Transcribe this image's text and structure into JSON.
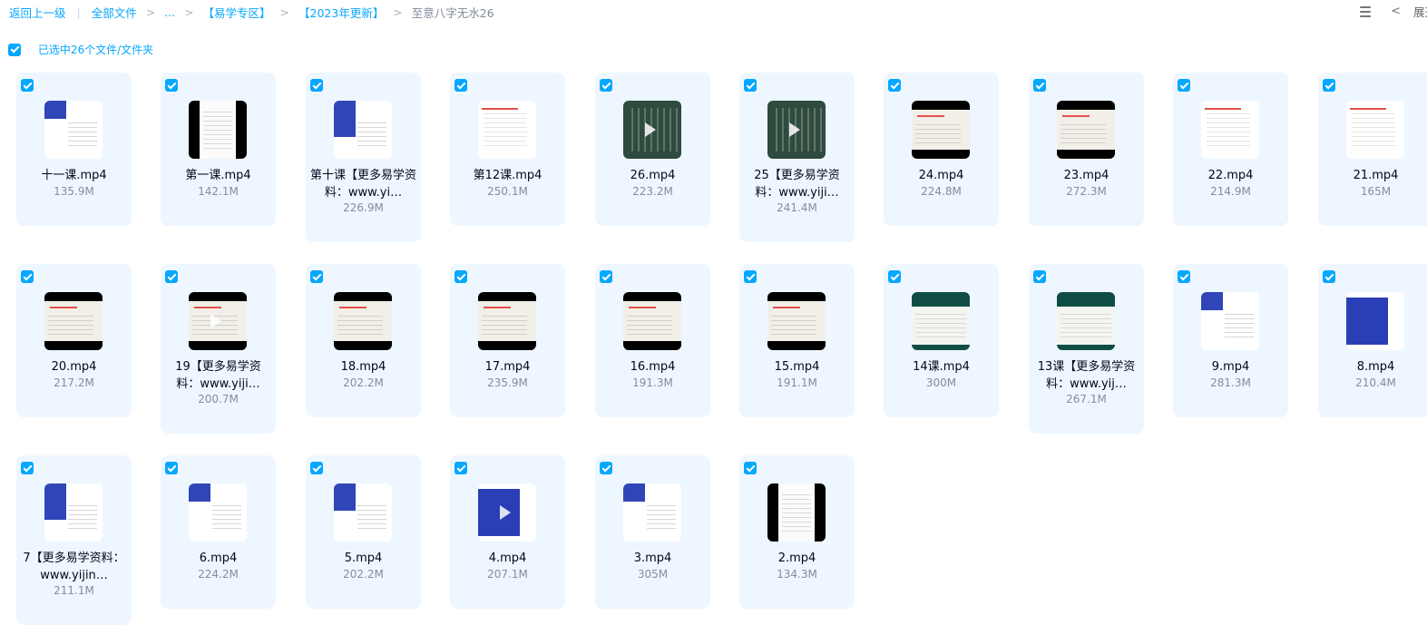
{
  "breadcrumb": {
    "back": "返回上一级",
    "items": [
      "全部文件",
      "...",
      "【易学专区】",
      "【2023年更新】"
    ],
    "current": "至意八字无水26"
  },
  "toolbar": {
    "list_view_icon": "list-view-icon",
    "collapse_icon": "chevron-left-icon",
    "expand_label": "展开"
  },
  "selection": {
    "label": "已选中26个文件/文件夹"
  },
  "colors": {
    "accent": "#06a7ff",
    "card_bg": "#eef7ff",
    "size_text": "#878c9c"
  },
  "files": [
    {
      "name": "十一课.mp4",
      "size": "135.9M"
    },
    {
      "name": "第一课.mp4",
      "size": "142.1M"
    },
    {
      "name": "第十课【更多易学资料：www.yi…",
      "size": "226.9M"
    },
    {
      "name": "第12课.mp4",
      "size": "250.1M"
    },
    {
      "name": "26.mp4",
      "size": "223.2M"
    },
    {
      "name": "25【更多易学资料：www.yiji…",
      "size": "241.4M"
    },
    {
      "name": "24.mp4",
      "size": "224.8M"
    },
    {
      "name": "23.mp4",
      "size": "272.3M"
    },
    {
      "name": "22.mp4",
      "size": "214.9M"
    },
    {
      "name": "21.mp4",
      "size": "165M"
    },
    {
      "name": "20.mp4",
      "size": "217.2M"
    },
    {
      "name": "19【更多易学资料：www.yiji…",
      "size": "200.7M"
    },
    {
      "name": "18.mp4",
      "size": "202.2M"
    },
    {
      "name": "17.mp4",
      "size": "235.9M"
    },
    {
      "name": "16.mp4",
      "size": "191.3M"
    },
    {
      "name": "15.mp4",
      "size": "191.1M"
    },
    {
      "name": "14课.mp4",
      "size": "300M"
    },
    {
      "name": "13课【更多易学资料：www.yij…",
      "size": "267.1M"
    },
    {
      "name": "9.mp4",
      "size": "281.3M"
    },
    {
      "name": "8.mp4",
      "size": "210.4M"
    },
    {
      "name": "7【更多易学资料：www.yijin…",
      "size": "211.1M"
    },
    {
      "name": "6.mp4",
      "size": "224.2M"
    },
    {
      "name": "5.mp4",
      "size": "202.2M"
    },
    {
      "name": "4.mp4",
      "size": "207.1M"
    },
    {
      "name": "3.mp4",
      "size": "305M"
    },
    {
      "name": "2.mp4",
      "size": "134.3M"
    }
  ]
}
